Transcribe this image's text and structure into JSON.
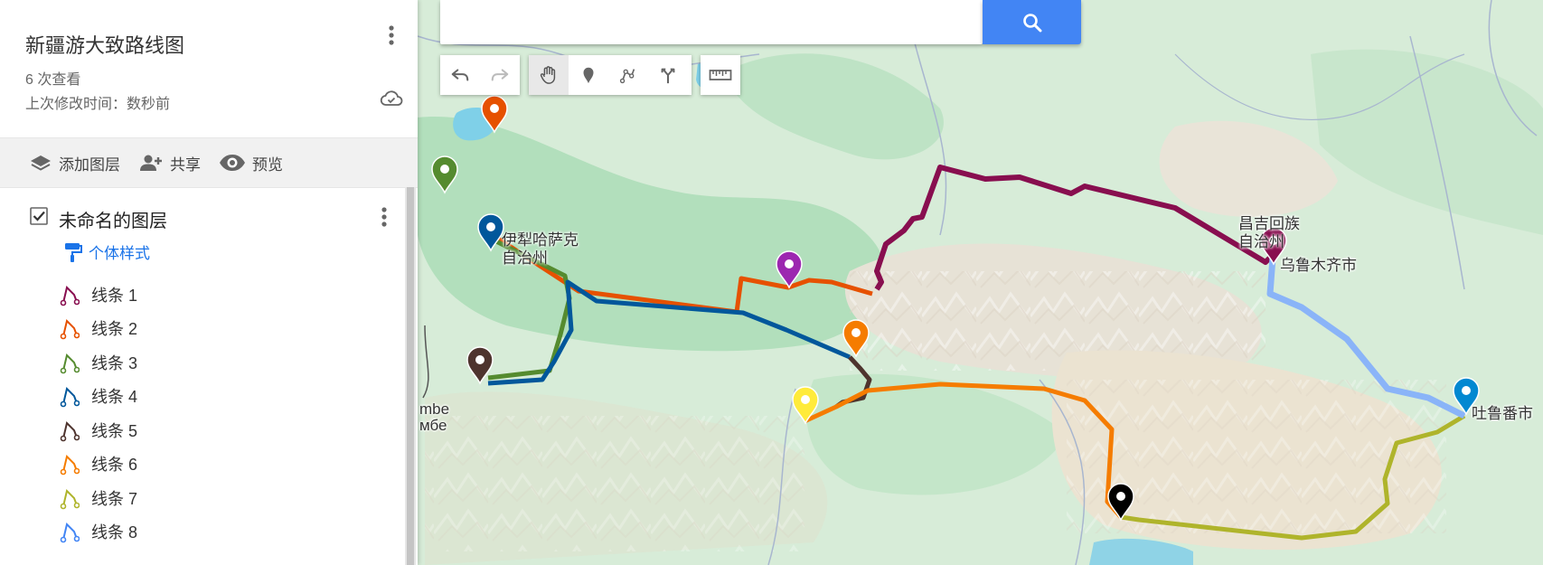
{
  "sidebar": {
    "title": "新疆游大致路线图",
    "views": "6 次查看",
    "modified": "上次修改时间：数秒前",
    "actions": {
      "add_layer": "添加图层",
      "share": "共享",
      "preview": "预览"
    },
    "layer": {
      "name": "未命名的图层",
      "style_link": "个体样式",
      "lines": [
        {
          "label": "线条 1",
          "color": "#880e4f"
        },
        {
          "label": "线条 2",
          "color": "#e65100"
        },
        {
          "label": "线条 3",
          "color": "#558b2f"
        },
        {
          "label": "线条 4",
          "color": "#01579b"
        },
        {
          "label": "线条 5",
          "color": "#4e342e"
        },
        {
          "label": "线条 6",
          "color": "#f57c00"
        },
        {
          "label": "线条 7",
          "color": "#afb42b"
        },
        {
          "label": "线条 8",
          "color": "#4285f4"
        }
      ]
    }
  },
  "search": {
    "placeholder": ""
  },
  "toolbar": {
    "tools": [
      "undo-icon",
      "redo-icon",
      "hand-icon",
      "marker-icon",
      "draw-line-icon",
      "directions-icon",
      "ruler-icon"
    ]
  },
  "map": {
    "labels": {
      "yili": "伊犁哈萨克",
      "yili2": "自治州",
      "changji": "昌吉回族",
      "changji2": "自治州",
      "urumqi": "乌鲁木齐市",
      "turpan": "吐鲁番市",
      "mbe1": "mbe",
      "mbe2": "мбе"
    },
    "marker_colors": [
      "#e65100",
      "#558b2f",
      "#01579b",
      "#4e342e",
      "#9c27b0",
      "#f57c00",
      "#ffeb3b",
      "#880e4f",
      "#0288d1",
      "#000000"
    ]
  }
}
